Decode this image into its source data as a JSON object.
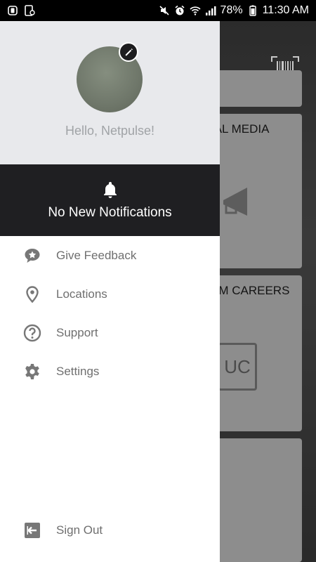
{
  "status_bar": {
    "battery": "78%",
    "time": "11:30 AM",
    "icons": [
      "app-notification-icon",
      "sim-icon",
      "mute-icon",
      "alarm-icon",
      "wifi-icon",
      "signal-icon",
      "battery-icon"
    ]
  },
  "profile": {
    "greeting": "Hello, Netpulse!",
    "edit_icon": "pencil-icon"
  },
  "notifications": {
    "text": "No New Notifications",
    "icon": "bell-icon"
  },
  "menu": {
    "items": [
      {
        "label": "Give Feedback",
        "icon": "feedback-star-icon"
      },
      {
        "label": "Locations",
        "icon": "location-pin-icon"
      },
      {
        "label": "Support",
        "icon": "help-circle-icon"
      },
      {
        "label": "Settings",
        "icon": "gear-icon"
      }
    ],
    "sign_out": {
      "label": "Sign Out",
      "icon": "sign-out-icon"
    }
  },
  "background": {
    "cards": [
      {
        "title": ""
      },
      {
        "title": "IAL MEDIA"
      },
      {
        "title": "YM CAREERS",
        "badge": "UC"
      },
      {
        "title": ""
      }
    ],
    "barcode_icon": "barcode-icon"
  },
  "colors": {
    "drawer_header_bg": "#e8e9ec",
    "notification_bg": "#1f1f22",
    "menu_text": "#6f6f6f",
    "icon_gray": "#777777"
  }
}
